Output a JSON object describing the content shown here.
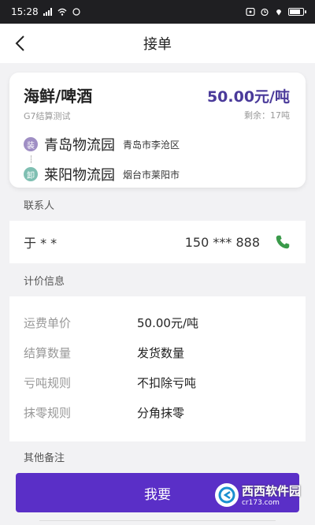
{
  "status": {
    "time": "15:28"
  },
  "header": {
    "title": "接单"
  },
  "order": {
    "cargo": "海鲜/啤酒",
    "price": "50.00元/吨",
    "settlement_note": "G7结算测试",
    "remaining": "剩余：17吨",
    "route": [
      {
        "tag": "装",
        "place": "青岛物流园",
        "city": "青岛市李沧区"
      },
      {
        "tag": "卸",
        "place": "莱阳物流园",
        "city": "烟台市莱阳市"
      }
    ]
  },
  "contact": {
    "section_label": "联系人",
    "name": "于 * *",
    "phone": "150 *** 888"
  },
  "pricing": {
    "section_label": "计价信息",
    "rows": [
      {
        "key": "运费单价",
        "value": "50.00元/吨"
      },
      {
        "key": "结算数量",
        "value": "发货数量"
      },
      {
        "key": "亏吨规则",
        "value": "不扣除亏吨"
      },
      {
        "key": "抹零规则",
        "value": "分角抹零"
      }
    ]
  },
  "remarks": {
    "section_label": "其他备注"
  },
  "action": {
    "label": "我要"
  },
  "watermark": {
    "text": "西西软件园",
    "sub": "cr173.com"
  },
  "colors": {
    "accent": "#5a2fc7",
    "price": "#4a3a9a",
    "call": "#3a9a4a"
  }
}
